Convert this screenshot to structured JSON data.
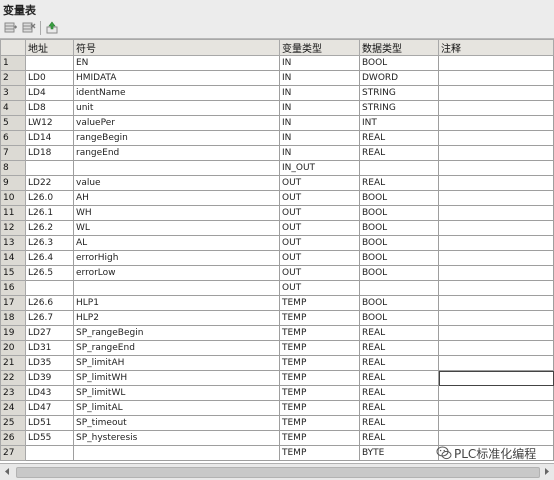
{
  "title": "变量表",
  "toolbar": {
    "insert_icon": "insert-row-icon",
    "delete_icon": "delete-row-icon",
    "info_icon": "up-arrow-icon"
  },
  "table": {
    "columns": [
      "地址",
      "符号",
      "变量类型",
      "数据类型",
      "注释"
    ],
    "rows": [
      [
        "1",
        "",
        "EN",
        "IN",
        "BOOL",
        ""
      ],
      [
        "2",
        "LD0",
        "HMIDATA",
        "IN",
        "DWORD",
        ""
      ],
      [
        "3",
        "LD4",
        "identName",
        "IN",
        "STRING",
        ""
      ],
      [
        "4",
        "LD8",
        "unit",
        "IN",
        "STRING",
        ""
      ],
      [
        "5",
        "LW12",
        "valuePer",
        "IN",
        "INT",
        ""
      ],
      [
        "6",
        "LD14",
        "rangeBegin",
        "IN",
        "REAL",
        ""
      ],
      [
        "7",
        "LD18",
        "rangeEnd",
        "IN",
        "REAL",
        ""
      ],
      [
        "8",
        "",
        "",
        "IN_OUT",
        "",
        ""
      ],
      [
        "9",
        "LD22",
        "value",
        "OUT",
        "REAL",
        ""
      ],
      [
        "10",
        "L26.0",
        "AH",
        "OUT",
        "BOOL",
        ""
      ],
      [
        "11",
        "L26.1",
        "WH",
        "OUT",
        "BOOL",
        ""
      ],
      [
        "12",
        "L26.2",
        "WL",
        "OUT",
        "BOOL",
        ""
      ],
      [
        "13",
        "L26.3",
        "AL",
        "OUT",
        "BOOL",
        ""
      ],
      [
        "14",
        "L26.4",
        "errorHigh",
        "OUT",
        "BOOL",
        ""
      ],
      [
        "15",
        "L26.5",
        "errorLow",
        "OUT",
        "BOOL",
        ""
      ],
      [
        "16",
        "",
        "",
        "OUT",
        "",
        ""
      ],
      [
        "17",
        "L26.6",
        "HLP1",
        "TEMP",
        "BOOL",
        ""
      ],
      [
        "18",
        "L26.7",
        "HLP2",
        "TEMP",
        "BOOL",
        ""
      ],
      [
        "19",
        "LD27",
        "SP_rangeBegin",
        "TEMP",
        "REAL",
        ""
      ],
      [
        "20",
        "LD31",
        "SP_rangeEnd",
        "TEMP",
        "REAL",
        ""
      ],
      [
        "21",
        "LD35",
        "SP_limitAH",
        "TEMP",
        "REAL",
        ""
      ],
      [
        "22",
        "LD39",
        "SP_limitWH",
        "TEMP",
        "REAL",
        ""
      ],
      [
        "23",
        "LD43",
        "SP_limitWL",
        "TEMP",
        "REAL",
        ""
      ],
      [
        "24",
        "LD47",
        "SP_limitAL",
        "TEMP",
        "REAL",
        ""
      ],
      [
        "25",
        "LD51",
        "SP_timeout",
        "TEMP",
        "REAL",
        ""
      ],
      [
        "26",
        "LD55",
        "SP_hysteresis",
        "TEMP",
        "REAL",
        ""
      ],
      [
        "27",
        "",
        "",
        "TEMP",
        "BYTE",
        ""
      ]
    ]
  },
  "watermark": "PLC标准化编程"
}
